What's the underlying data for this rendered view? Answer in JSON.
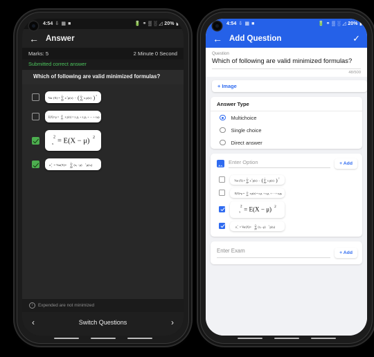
{
  "statusbar": {
    "time": "4:54",
    "left_icons": [
      "download-icon",
      "image-icon",
      "square-icon"
    ],
    "right_icons": [
      "battery-saver-icon",
      "wifi-calling-icon",
      "sim1-signal-icon",
      "sim2-signal-icon",
      "signal-icon"
    ],
    "battery": "20%"
  },
  "left_phone": {
    "appbar": {
      "back": "←",
      "title": "Answer"
    },
    "marks_label": "Marks: 5",
    "timer_label": "2 Minute 0 Second",
    "status_text": "Submitted correct answer",
    "status_color": "#4cc55d",
    "question": "Which of following are valid minimized formulas?",
    "options": [
      {
        "checked": false,
        "formula": "Var (X) = Σ xᵢ² p(xᵢ) − ( Σ xᵢ p(xᵢ) )²",
        "size": "small"
      },
      {
        "checked": false,
        "formula": "E(X) = μ = Σ xᵢ p(xᵢ) = x₁p₁ + x₂p₂ + ⋯ + xₙpₙ",
        "size": "small"
      },
      {
        "checked": true,
        "formula": "σₓ² = E(X − μ)²",
        "size": "big"
      },
      {
        "checked": true,
        "formula": "σₓ² = Var(X) = Σ (xᵢ − μ)² p(xᵢ)",
        "size": "small"
      }
    ],
    "footer_note": "Expended are not minimized",
    "switch_label": "Switch Questions",
    "prev_arrow": "‹",
    "next_arrow": "›"
  },
  "right_phone": {
    "appbar": {
      "back": "←",
      "title": "Add Question",
      "confirm": "✓",
      "color": "#2561e8"
    },
    "question_label": "Question",
    "question_text": "Which of following are valid minimized formulas?",
    "char_count": "48/500",
    "image_button": "+ Image",
    "answer_type": {
      "title": "Answer Type",
      "options": [
        {
          "label": "Multichoice",
          "selected": true
        },
        {
          "label": "Single choice",
          "selected": false
        },
        {
          "label": "Direct answer",
          "selected": false
        }
      ]
    },
    "option_section": {
      "picker_icon": "image-picker-icon",
      "input_placeholder": "Enter Option",
      "add_label": "+ Add",
      "options": [
        {
          "checked": false,
          "formula": "Var (X) = Σ xᵢ² p(xᵢ) − ( Σ xᵢ p(xᵢ) )²",
          "size": "small"
        },
        {
          "checked": false,
          "formula": "E(X) = μ = Σ xᵢ p(xᵢ) = x₁p₁ + x₂p₂ + ⋯ + xₙpₙ",
          "size": "small"
        },
        {
          "checked": true,
          "formula": "σₓ² = E(X − μ)²",
          "size": "big"
        },
        {
          "checked": true,
          "formula": "σₓ² = Var(X) = Σ (xᵢ − μ)² p(xᵢ)",
          "size": "small"
        }
      ]
    },
    "exam_section": {
      "input_placeholder": "Enter Exam",
      "add_label": "+ Add"
    }
  },
  "colors": {
    "accent_blue": "#2f6bf0",
    "appbar_blue": "#2561e8",
    "green_check": "#4cae4f",
    "dark_bg": "#1b1b1b",
    "light_bg": "#f1f2f5"
  }
}
